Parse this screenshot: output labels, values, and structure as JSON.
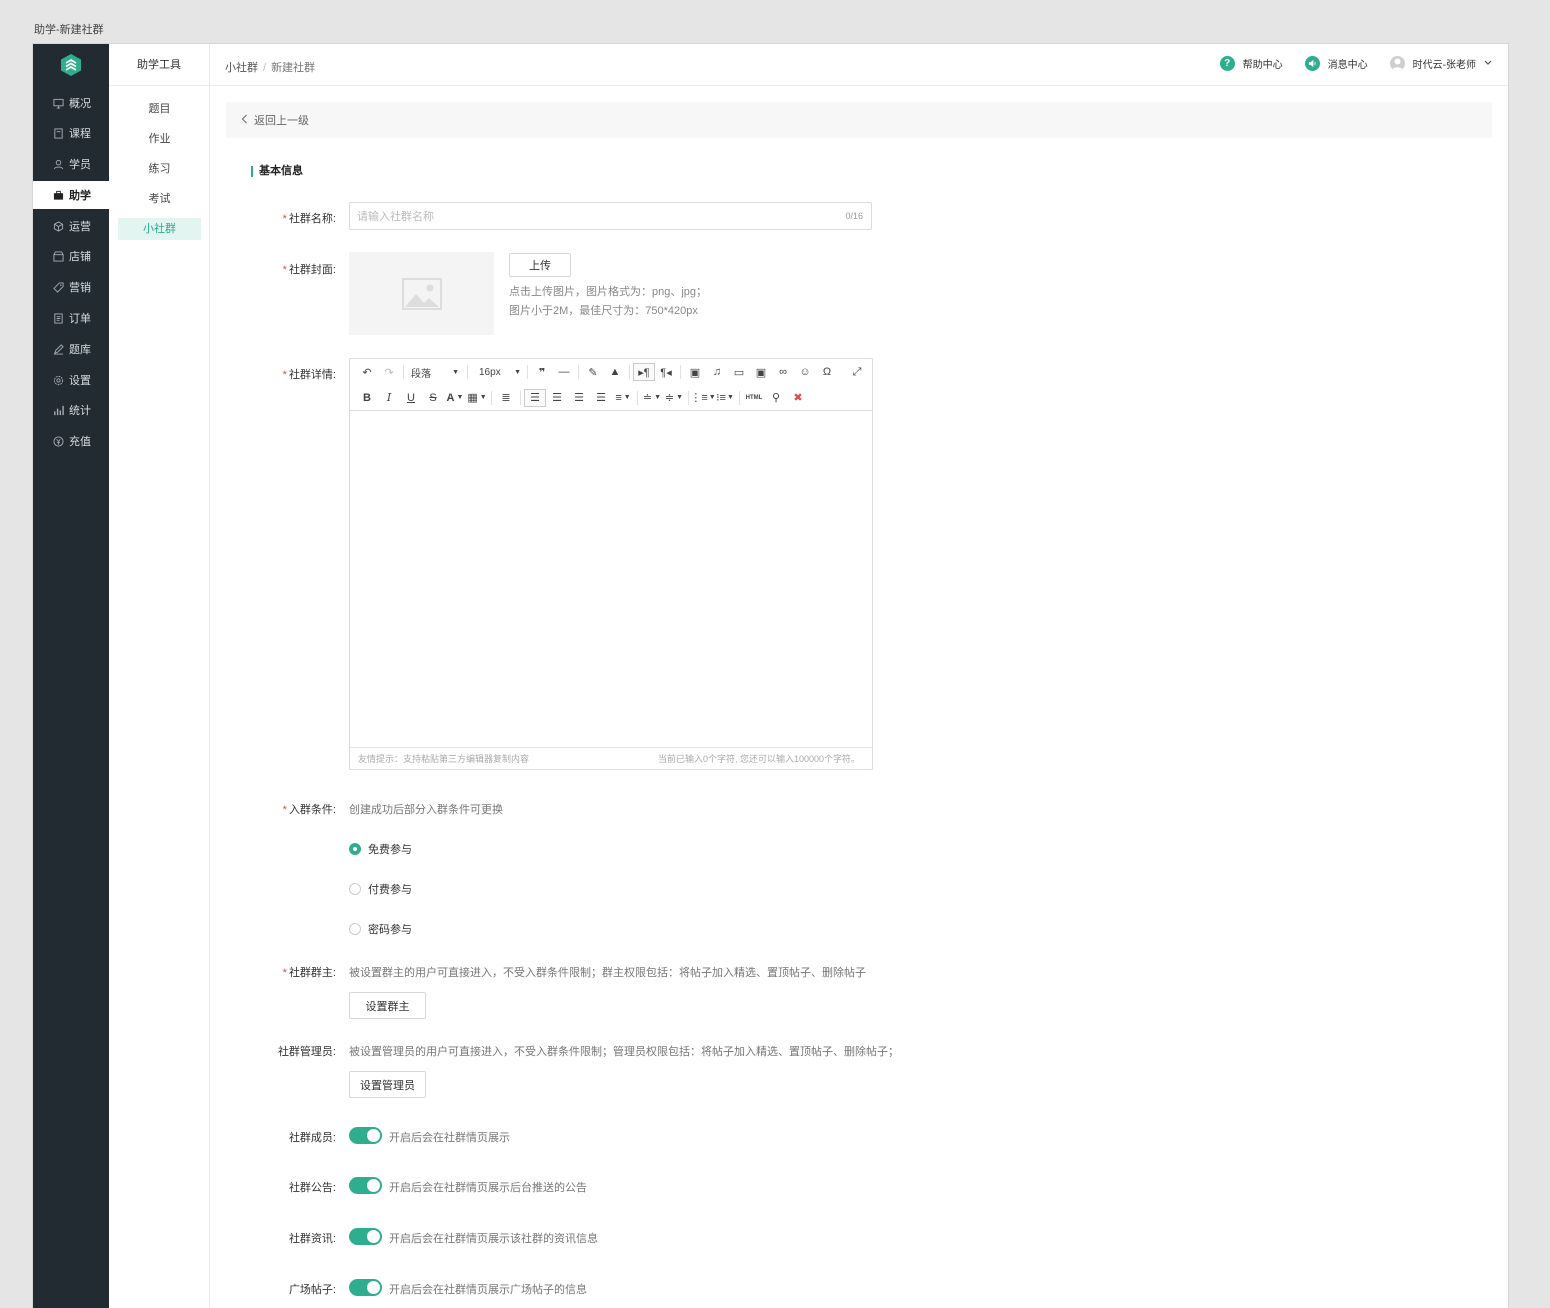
{
  "window_title": "助学-新建社群",
  "sidebar": {
    "items": [
      {
        "label": "概况",
        "icon": "monitor-icon"
      },
      {
        "label": "课程",
        "icon": "book-icon"
      },
      {
        "label": "学员",
        "icon": "user-icon"
      },
      {
        "label": "助学",
        "icon": "briefcase-icon",
        "active": true
      },
      {
        "label": "运营",
        "icon": "cube-icon"
      },
      {
        "label": "店铺",
        "icon": "store-icon"
      },
      {
        "label": "营销",
        "icon": "tag-icon"
      },
      {
        "label": "订单",
        "icon": "document-icon"
      },
      {
        "label": "题库",
        "icon": "pen-icon"
      },
      {
        "label": "设置",
        "icon": "gear-icon"
      },
      {
        "label": "统计",
        "icon": "bar-chart-icon"
      },
      {
        "label": "充值",
        "icon": "yuan-icon"
      }
    ]
  },
  "subnav": {
    "title": "助学工具",
    "items": [
      "题目",
      "作业",
      "练习",
      "考试",
      "小社群"
    ],
    "active_index": 4
  },
  "breadcrumb": {
    "parent": "小社群",
    "separator": "/",
    "current": "新建社群"
  },
  "header": {
    "help": "帮助中心",
    "messages": "消息中心",
    "user": "时代云-张老师"
  },
  "back_label": "返回上一级",
  "section_title": "基本信息",
  "form": {
    "name_label": "社群名称:",
    "name_placeholder": "请输入社群名称",
    "name_counter": "0/16",
    "cover_label": "社群封面:",
    "upload_button": "上传",
    "cover_hint_1": "点击上传图片，图片格式为：png、jpg；",
    "cover_hint_2": "图片小于2M，最佳尺寸为：750*420px",
    "detail_label": "社群详情:",
    "editor": {
      "paragraph": "段落",
      "font_size": "16px",
      "footer_left": "友情提示：支持粘贴第三方编辑器复制内容",
      "footer_right": "当前已输入0个字符, 您还可以输入100000个字符。"
    },
    "condition_label": "入群条件:",
    "condition_desc": "创建成功后部分入群条件可更换",
    "condition_options": [
      "免费参与",
      "付费参与",
      "密码参与"
    ],
    "condition_selected": 0,
    "owner_label": "社群群主:",
    "owner_desc": "被设置群主的用户可直接进入，不受入群条件限制；群主权限包括：将帖子加入精选、置顶帖子、删除帖子",
    "owner_button": "设置群主",
    "admin_label": "社群管理员:",
    "admin_desc": "被设置管理员的用户可直接进入，不受入群条件限制；管理员权限包括：将帖子加入精选、置顶帖子、删除帖子；",
    "admin_button": "设置管理员",
    "toggles": [
      {
        "label": "社群成员:",
        "desc": "开启后会在社群情页展示",
        "on": true
      },
      {
        "label": "社群公告:",
        "desc": "开启后会在社群情页展示后台推送的公告",
        "on": true
      },
      {
        "label": "社群资讯:",
        "desc": "开启后会在社群情页展示该社群的资讯信息",
        "on": true
      },
      {
        "label": "广场帖子:",
        "desc": "开启后会在社群情页展示广场帖子的信息",
        "on": true
      }
    ]
  },
  "colors": {
    "accent": "#2eae8e",
    "sidebar_bg": "#222b31",
    "required": "#e04b4b"
  }
}
